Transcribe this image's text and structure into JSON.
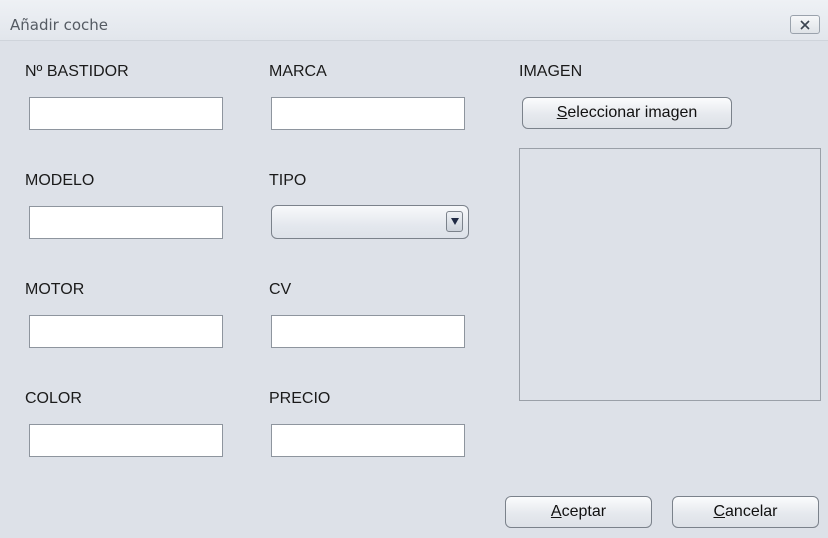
{
  "window": {
    "title": "Añadir coche",
    "close_icon": "close-x-icon"
  },
  "form": {
    "bastidor": {
      "label": "Nº BASTIDOR",
      "value": ""
    },
    "marca": {
      "label": "MARCA",
      "value": ""
    },
    "modelo": {
      "label": "MODELO",
      "value": ""
    },
    "tipo": {
      "label": "TIPO",
      "selected": ""
    },
    "motor": {
      "label": "MOTOR",
      "value": ""
    },
    "cv": {
      "label": "CV",
      "value": ""
    },
    "color": {
      "label": "COLOR",
      "value": ""
    },
    "precio": {
      "label": "PRECIO",
      "value": ""
    }
  },
  "image": {
    "label": "IMAGEN",
    "select_button": {
      "mnemonic": "S",
      "rest": "eleccionar imagen"
    }
  },
  "buttons": {
    "accept": {
      "mnemonic": "A",
      "rest": "ceptar"
    },
    "cancel": {
      "mnemonic": "C",
      "rest": "ancelar"
    }
  }
}
